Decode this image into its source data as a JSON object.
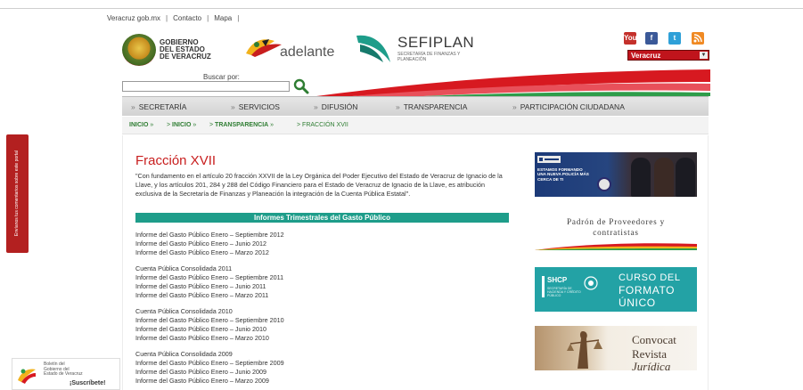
{
  "top_links": {
    "items": [
      "Veracruz gob.mx",
      "Contacto",
      "Mapa"
    ],
    "separator": "|"
  },
  "logos": {
    "gobierno_line1": "GOBIERNO",
    "gobierno_line2": "DEL ESTADO",
    "gobierno_line3": "DE VERACRUZ",
    "adelante": "adelante",
    "sefiplan": "SEFIPLAN",
    "sefiplan_sub": "SECRETARÍA DE FINANZAS Y PLANEACIÓN"
  },
  "social": {
    "items": [
      "youtube-icon",
      "facebook-icon",
      "twitter-icon",
      "rss-icon"
    ],
    "youtube_text": "You",
    "facebook_text": "f",
    "twitter_text": "t"
  },
  "state_select": {
    "value": "Veracruz",
    "arrow": "▼"
  },
  "search": {
    "label": "Buscar por:",
    "value": ""
  },
  "nav": {
    "bullet": "»",
    "items": [
      "SECRETARÍA",
      "SERVICIOS",
      "DIFUSIÓN",
      "TRANSPARENCIA",
      "PARTICIPACIÓN CIUDADANA"
    ]
  },
  "breadcrumb": {
    "items": [
      "INICIO",
      "INICIO",
      "TRANSPARENCIA",
      "FRACCIÓN XVII"
    ],
    "separator": "»",
    "prefix": ">"
  },
  "main": {
    "title": "Fracción XVII",
    "intro": "\"Con fundamento en el artículo 20 fracción XXVII de la Ley Orgánica del Poder Ejecutivo del Estado de Veracruz de Ignacio de la Llave, y los artículos 201, 284 y 288 del Código Financiero para el Estado de Veracruz de Ignacio de la Llave, es atribución exclusiva de la Secretaría de Finanzas y Planeación la integración de la Cuenta Pública Estatal\".",
    "section_header": "Informes Trimestrales del Gasto Público",
    "reports": [
      "Informe del Gasto Público Enero – Septiembre 2012",
      "Informe del Gasto Público Enero – Junio 2012",
      "Informe del Gasto Público Enero – Marzo 2012",
      "Cuenta Pública Consolidada 2011",
      "Informe del Gasto Público Enero – Septiembre 2011",
      "Informe del Gasto Público Enero – Junio 2011",
      "Informe del Gasto Público Enero – Marzo 2011",
      "Cuenta Pública Consolidada 2010",
      "Informe del Gasto Público Enero – Septiembre 2010",
      "Informe del Gasto Público Enero – Junio 2010",
      "Informe del Gasto Público Enero – Marzo 2010",
      "Cuenta Pública Consolidada 2009",
      "Informe del Gasto Público Enero – Septiembre 2009",
      "Informe del Gasto Público Enero – Junio 2009",
      "Informe del Gasto Público Enero – Marzo 2009"
    ]
  },
  "sidebar": {
    "police_text": "ESTAMOS FORMANDO UNA NUEVA POLICÍA MÁS CERCA DE TI",
    "padron_line1": "Padrón de Proveedores y",
    "padron_line2": "contratistas",
    "shcp_label": "SHCP",
    "shcp_sub": "SECRETARÍA DE HACIENDA Y CRÉDITO PÚBLICO",
    "curso_line1": "CURSO DEL",
    "curso_line2": "FORMATO",
    "curso_line3": "ÚNICO",
    "convoca_line1": "Convocat",
    "convoca_line2": "Revista",
    "convoca_line3": "Jurídica"
  },
  "feedback_tab": {
    "label": "Envíanos tus comentarios sobre este portal"
  },
  "newsletter": {
    "line1": "Boletín del",
    "line2": "Gobierno del",
    "line3": "Estado de Veracruz",
    "cta": "¡Suscríbete!"
  },
  "colors": {
    "accent_red": "#c81e1e",
    "teal": "#1e9d8a",
    "nav_bg": "#d9d9d9",
    "breadcrumb_green": "#2e7d32"
  }
}
